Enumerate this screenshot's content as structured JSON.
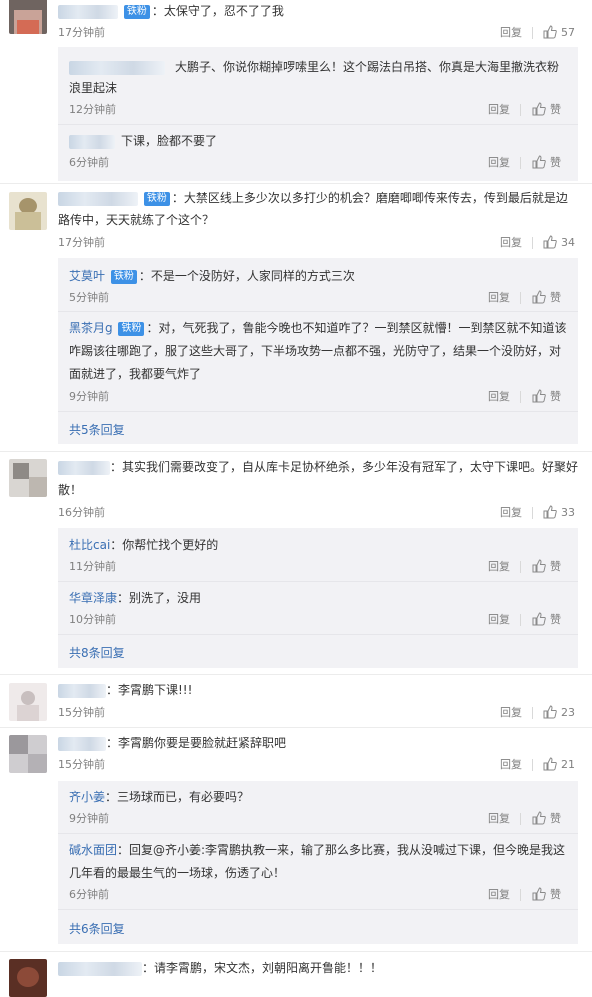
{
  "badge_label": "铁粉",
  "reply_label": "回复",
  "like_label": "赞",
  "comments": [
    {
      "text": "：太保守了，忍不了了我",
      "time": "17分钟前",
      "likes": "57",
      "replies": [
        {
          "text1": "大鹏子、你说你糊掉啰嗦里么！这个踢法白吊搭、你真是大海里撤洗衣粉",
          "text2": "浪里起沫",
          "time": "12分钟前"
        },
        {
          "text1": "下课，脸都不要了",
          "time": "6分钟前"
        }
      ]
    },
    {
      "text1": "：大禁区线上多少次以多打少的机会？磨磨唧唧传来传去，传到最后就是边",
      "text2": "路传中，天天就练了个这个？",
      "time": "17分钟前",
      "likes": "34",
      "replies": [
        {
          "name": "艾莫叶",
          "text1": "：不是一个没防好，人家同样的方式三次",
          "time": "5分钟前"
        },
        {
          "name": "黑茶月g",
          "text1": "：对，气死我了，鲁能今晚也不知道咋了？一到禁区就懵！一到禁区就不知道该",
          "text2": "咋踢该往哪跑了，服了这些大哥了，下半场攻势一点都不强，光防守了，结果一个没防好，对",
          "text3": "面就进了，我都要气炸了",
          "time": "9分钟前"
        }
      ],
      "more": "共5条回复"
    },
    {
      "text1": "：其实我们需要改变了，自从库卡足协杯绝杀，多少年没有冠军了，太守下课吧。好聚好",
      "text2": "散！",
      "time": "16分钟前",
      "likes": "33",
      "replies": [
        {
          "name": "杜比cai",
          "text1": "：你帮忙找个更好的",
          "time": "11分钟前"
        },
        {
          "name": "华章泽康",
          "text1": "：别洗了，没用",
          "time": "10分钟前"
        }
      ],
      "more": "共8条回复"
    },
    {
      "text": "：李霄鹏下课!!!",
      "time": "15分钟前",
      "likes": "23"
    },
    {
      "text": "：李霄鹏你要是要脸就赶紧辞职吧",
      "time": "15分钟前",
      "likes": "21",
      "replies": [
        {
          "name": "齐小姜",
          "text1": "：三场球而已，有必要吗？",
          "time": "9分钟前"
        },
        {
          "name": "碱水面团",
          "text1": "：回复@齐小姜:李霄鹏执教一来，输了那么多比赛，我从没喊过下课，但今晚是我这",
          "text2": "几年看的最最生气的一场球，伤透了心！",
          "time": "6分钟前"
        }
      ],
      "more": "共6条回复"
    },
    {
      "text": "：请李霄鹏，宋文杰，刘朝阳离开鲁能！！！"
    }
  ],
  "colors": {
    "accent": "#3a6fb3",
    "badge": "#3d91e6",
    "reply_bg": "#f2f2f5",
    "meta": "#808080"
  }
}
